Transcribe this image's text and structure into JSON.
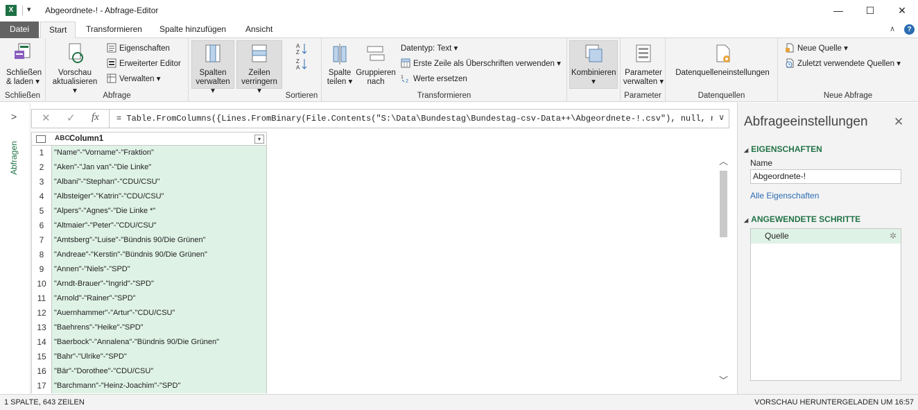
{
  "window": {
    "app_icon": "excel-icon",
    "title": "Abgeordnete-! - Abfrage-Editor",
    "controls": {
      "minimize": "—",
      "maximize": "☐",
      "close": "✕"
    }
  },
  "tabs": {
    "file": "Datei",
    "items": [
      "Start",
      "Transformieren",
      "Spalte hinzufügen",
      "Ansicht"
    ],
    "active": "Start",
    "right": {
      "collapse": "∧",
      "help": "?"
    }
  },
  "ribbon": {
    "groups": {
      "close": {
        "label": "Schließen",
        "close_load": "Schließen & laden ▾"
      },
      "query": {
        "label": "Abfrage",
        "refresh": "Vorschau aktualisieren ▾",
        "properties": "Eigenschaften",
        "advanced_editor": "Erweiterter Editor",
        "manage": "Verwalten ▾"
      },
      "columns": {
        "manage_columns": "Spalten verwalten ▾"
      },
      "rows": {
        "reduce_rows": "Zeilen verringern ▾"
      },
      "sort": {
        "label": "Sortieren"
      },
      "transform": {
        "label": "Transformieren",
        "split": "Spalte teilen ▾",
        "group": "Gruppieren nach",
        "datatype": "Datentyp: Text ▾",
        "first_row_header": "Erste Zeile als Überschriften verwenden ▾",
        "replace_values": "Werte ersetzen"
      },
      "combine": {
        "combine": "Kombinieren ▾"
      },
      "params": {
        "label": "Parameter",
        "manage_params": "Parameter verwalten ▾"
      },
      "datasources": {
        "label": "Datenquellen",
        "settings": "Datenquelleneinstellungen"
      },
      "newquery": {
        "label": "Neue Abfrage",
        "new_source": "Neue Quelle ▾",
        "recent_sources": "Zuletzt verwendete Quellen ▾"
      }
    }
  },
  "formula_bar": {
    "cancel": "✕",
    "confirm": "✓",
    "fx": "fx",
    "text": "= Table.FromColumns({Lines.FromBinary(File.Contents(\"S:\\Data\\Bundestag\\Bundestag-csv-Data++\\Abgeordnete-!.csv\"), null, null,",
    "expand": "∨"
  },
  "left_nav": {
    "toggle": ">",
    "label": "Abfragen"
  },
  "grid": {
    "type_label": "ABC",
    "column": "Column1",
    "rows": [
      {
        "n": "1",
        "v": "\"Name\"-\"Vorname\"-\"Fraktion\""
      },
      {
        "n": "2",
        "v": "\"Aken\"-\"Jan van\"-\"Die Linke\""
      },
      {
        "n": "3",
        "v": "\"Albani\"-\"Stephan\"-\"CDU/CSU\""
      },
      {
        "n": "4",
        "v": "\"Albsteiger\"-\"Katrin\"-\"CDU/CSU\""
      },
      {
        "n": "5",
        "v": "\"Alpers\"-\"Agnes\"-\"Die Linke *\""
      },
      {
        "n": "6",
        "v": "\"Altmaier\"-\"Peter\"-\"CDU/CSU\""
      },
      {
        "n": "7",
        "v": "\"Amtsberg\"-\"Luise\"-\"Bündnis 90/Die Grünen\""
      },
      {
        "n": "8",
        "v": "\"Andreae\"-\"Kerstin\"-\"Bündnis 90/Die Grünen\""
      },
      {
        "n": "9",
        "v": "\"Annen\"-\"Niels\"-\"SPD\""
      },
      {
        "n": "10",
        "v": "\"Arndt-Brauer\"-\"Ingrid\"-\"SPD\""
      },
      {
        "n": "11",
        "v": "\"Arnold\"-\"Rainer\"-\"SPD\""
      },
      {
        "n": "12",
        "v": "\"Auernhammer\"-\"Artur\"-\"CDU/CSU\""
      },
      {
        "n": "13",
        "v": "\"Baehrens\"-\"Heike\"-\"SPD\""
      },
      {
        "n": "14",
        "v": "\"Baerbock\"-\"Annalena\"-\"Bündnis 90/Die Grünen\""
      },
      {
        "n": "15",
        "v": "\"Bahr\"-\"Ulrike\"-\"SPD\""
      },
      {
        "n": "16",
        "v": "\"Bär\"-\"Dorothee\"-\"CDU/CSU\""
      },
      {
        "n": "17",
        "v": "\"Barchmann\"-\"Heinz-Joachim\"-\"SPD\""
      }
    ]
  },
  "settings": {
    "title": "Abfrageeinstellungen",
    "close": "✕",
    "properties_header": "EIGENSCHAFTEN",
    "name_label": "Name",
    "name_value": "Abgeordnete-!",
    "all_properties": "Alle Eigenschaften",
    "steps_header": "ANGEWENDETE SCHRITTE",
    "steps": [
      "Quelle"
    ]
  },
  "status": {
    "left": "1 SPALTE, 643 ZEILEN",
    "right": "VORSCHAU HERUNTERGELADEN UM 16:57"
  }
}
